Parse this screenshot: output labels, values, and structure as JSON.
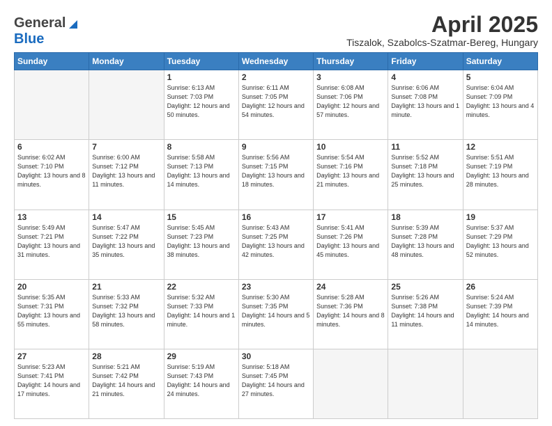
{
  "header": {
    "logo_general": "General",
    "logo_blue": "Blue",
    "title": "April 2025",
    "subtitle": "Tiszalok, Szabolcs-Szatmar-Bereg, Hungary"
  },
  "columns": [
    "Sunday",
    "Monday",
    "Tuesday",
    "Wednesday",
    "Thursday",
    "Friday",
    "Saturday"
  ],
  "weeks": [
    [
      {
        "day": "",
        "info": ""
      },
      {
        "day": "",
        "info": ""
      },
      {
        "day": "1",
        "info": "Sunrise: 6:13 AM\nSunset: 7:03 PM\nDaylight: 12 hours and 50 minutes."
      },
      {
        "day": "2",
        "info": "Sunrise: 6:11 AM\nSunset: 7:05 PM\nDaylight: 12 hours and 54 minutes."
      },
      {
        "day": "3",
        "info": "Sunrise: 6:08 AM\nSunset: 7:06 PM\nDaylight: 12 hours and 57 minutes."
      },
      {
        "day": "4",
        "info": "Sunrise: 6:06 AM\nSunset: 7:08 PM\nDaylight: 13 hours and 1 minute."
      },
      {
        "day": "5",
        "info": "Sunrise: 6:04 AM\nSunset: 7:09 PM\nDaylight: 13 hours and 4 minutes."
      }
    ],
    [
      {
        "day": "6",
        "info": "Sunrise: 6:02 AM\nSunset: 7:10 PM\nDaylight: 13 hours and 8 minutes."
      },
      {
        "day": "7",
        "info": "Sunrise: 6:00 AM\nSunset: 7:12 PM\nDaylight: 13 hours and 11 minutes."
      },
      {
        "day": "8",
        "info": "Sunrise: 5:58 AM\nSunset: 7:13 PM\nDaylight: 13 hours and 14 minutes."
      },
      {
        "day": "9",
        "info": "Sunrise: 5:56 AM\nSunset: 7:15 PM\nDaylight: 13 hours and 18 minutes."
      },
      {
        "day": "10",
        "info": "Sunrise: 5:54 AM\nSunset: 7:16 PM\nDaylight: 13 hours and 21 minutes."
      },
      {
        "day": "11",
        "info": "Sunrise: 5:52 AM\nSunset: 7:18 PM\nDaylight: 13 hours and 25 minutes."
      },
      {
        "day": "12",
        "info": "Sunrise: 5:51 AM\nSunset: 7:19 PM\nDaylight: 13 hours and 28 minutes."
      }
    ],
    [
      {
        "day": "13",
        "info": "Sunrise: 5:49 AM\nSunset: 7:21 PM\nDaylight: 13 hours and 31 minutes."
      },
      {
        "day": "14",
        "info": "Sunrise: 5:47 AM\nSunset: 7:22 PM\nDaylight: 13 hours and 35 minutes."
      },
      {
        "day": "15",
        "info": "Sunrise: 5:45 AM\nSunset: 7:23 PM\nDaylight: 13 hours and 38 minutes."
      },
      {
        "day": "16",
        "info": "Sunrise: 5:43 AM\nSunset: 7:25 PM\nDaylight: 13 hours and 42 minutes."
      },
      {
        "day": "17",
        "info": "Sunrise: 5:41 AM\nSunset: 7:26 PM\nDaylight: 13 hours and 45 minutes."
      },
      {
        "day": "18",
        "info": "Sunrise: 5:39 AM\nSunset: 7:28 PM\nDaylight: 13 hours and 48 minutes."
      },
      {
        "day": "19",
        "info": "Sunrise: 5:37 AM\nSunset: 7:29 PM\nDaylight: 13 hours and 52 minutes."
      }
    ],
    [
      {
        "day": "20",
        "info": "Sunrise: 5:35 AM\nSunset: 7:31 PM\nDaylight: 13 hours and 55 minutes."
      },
      {
        "day": "21",
        "info": "Sunrise: 5:33 AM\nSunset: 7:32 PM\nDaylight: 13 hours and 58 minutes."
      },
      {
        "day": "22",
        "info": "Sunrise: 5:32 AM\nSunset: 7:33 PM\nDaylight: 14 hours and 1 minute."
      },
      {
        "day": "23",
        "info": "Sunrise: 5:30 AM\nSunset: 7:35 PM\nDaylight: 14 hours and 5 minutes."
      },
      {
        "day": "24",
        "info": "Sunrise: 5:28 AM\nSunset: 7:36 PM\nDaylight: 14 hours and 8 minutes."
      },
      {
        "day": "25",
        "info": "Sunrise: 5:26 AM\nSunset: 7:38 PM\nDaylight: 14 hours and 11 minutes."
      },
      {
        "day": "26",
        "info": "Sunrise: 5:24 AM\nSunset: 7:39 PM\nDaylight: 14 hours and 14 minutes."
      }
    ],
    [
      {
        "day": "27",
        "info": "Sunrise: 5:23 AM\nSunset: 7:41 PM\nDaylight: 14 hours and 17 minutes."
      },
      {
        "day": "28",
        "info": "Sunrise: 5:21 AM\nSunset: 7:42 PM\nDaylight: 14 hours and 21 minutes."
      },
      {
        "day": "29",
        "info": "Sunrise: 5:19 AM\nSunset: 7:43 PM\nDaylight: 14 hours and 24 minutes."
      },
      {
        "day": "30",
        "info": "Sunrise: 5:18 AM\nSunset: 7:45 PM\nDaylight: 14 hours and 27 minutes."
      },
      {
        "day": "",
        "info": ""
      },
      {
        "day": "",
        "info": ""
      },
      {
        "day": "",
        "info": ""
      }
    ]
  ]
}
